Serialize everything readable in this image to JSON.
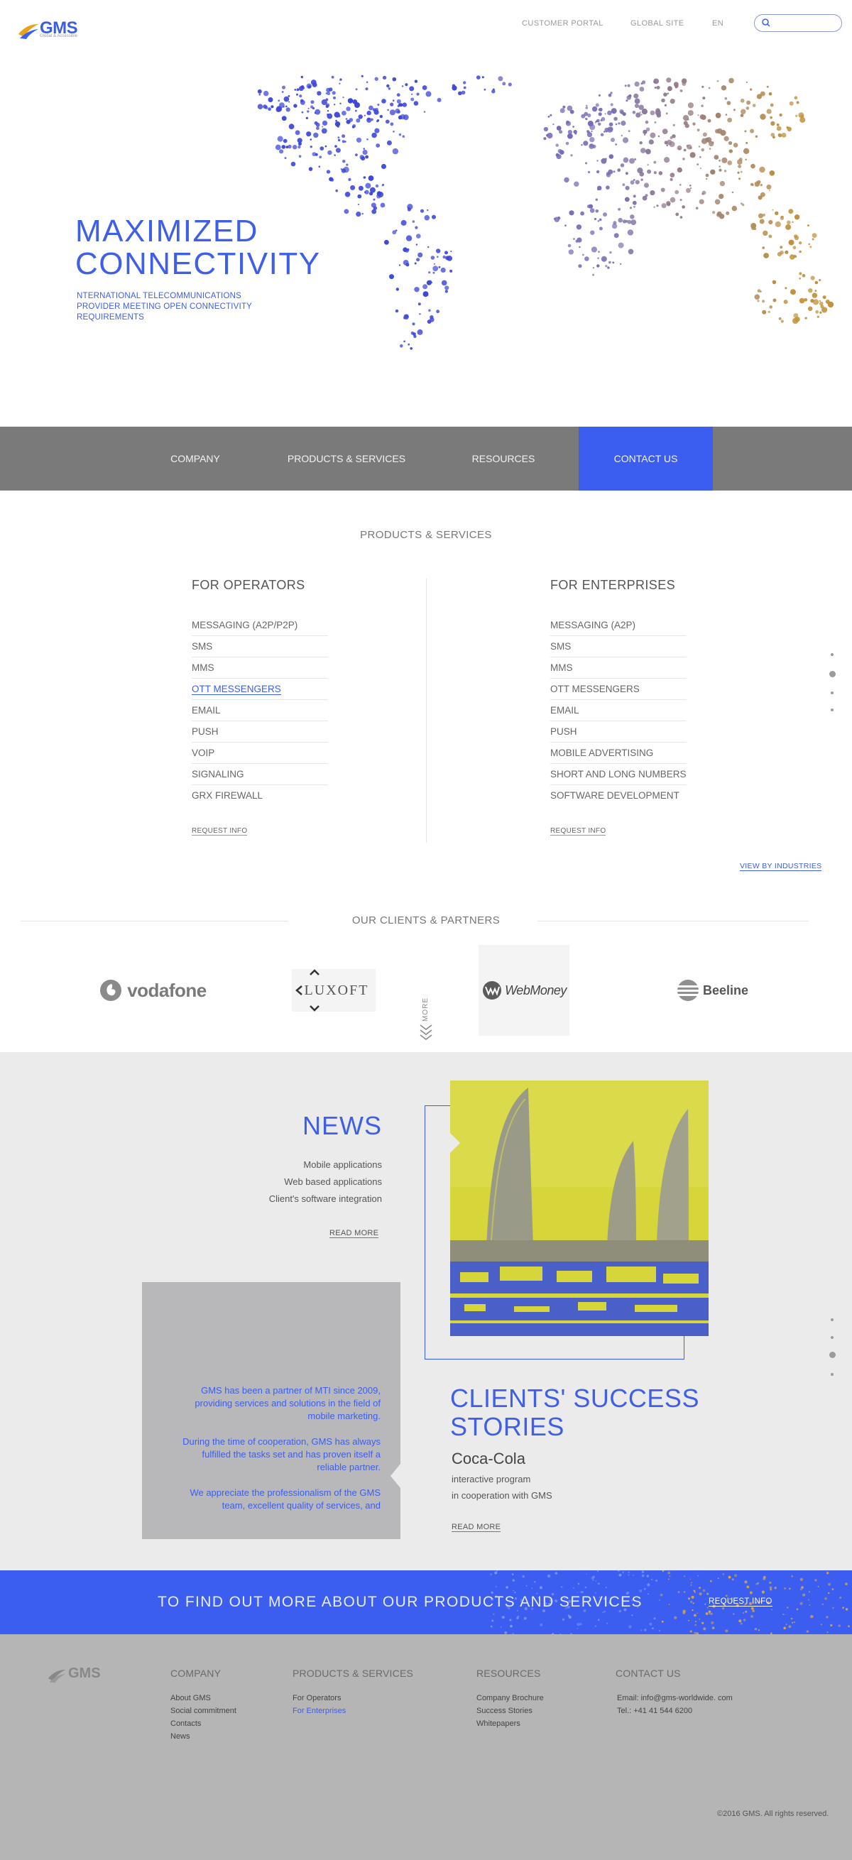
{
  "header": {
    "logo": "GMS",
    "logo_tagline": "Global & Accessible",
    "links": [
      "CUSTOMER PORTAL",
      "GLOBAL SITE",
      "EN"
    ],
    "search_placeholder": ""
  },
  "hero": {
    "title_line1": "MAXIMIZED",
    "title_line2": "CONNECTIVITY",
    "subtitle": "NTERNATIONAL TELECOMMUNICATIONS PROVIDER MEETING OPEN CONNECTIVITY REQUIREMENTS"
  },
  "nav": {
    "items": [
      "COMPANY",
      "PRODUCTS & SERVICES",
      "RESOURCES",
      "CONTACT US"
    ]
  },
  "products": {
    "title": "PRODUCTS & SERVICES",
    "operators": {
      "heading": "FOR OPERATORS",
      "items": [
        "MESSAGING (A2P/P2P)",
        "SMS",
        "MMS",
        "OTT MESSENGERS",
        "EMAIL",
        "PUSH",
        "VOIP",
        "SIGNALING",
        "GRX  FIREWALL"
      ],
      "request": "REQUEST INFO"
    },
    "enterprises": {
      "heading": "FOR  ENTERPRISES",
      "items": [
        "MESSAGING (A2P)",
        "SMS",
        "MMS",
        "OTT MESSENGERS",
        "EMAIL",
        "PUSH",
        "MOBILE ADVERTISING",
        "SHORT AND LONG NUMBERS",
        "SOFTWARE DEVELOPMENT"
      ],
      "request": "REQUEST INFO"
    },
    "view_industries": "VIEW BY INDUSTRIES"
  },
  "clients": {
    "title": "OUR CLIENTS & PARTNERS",
    "logos": [
      "vodafone",
      "LUXOFT",
      "WebMoney",
      "Beeline"
    ],
    "more": "MORE"
  },
  "news": {
    "title": "NEWS",
    "lines": [
      "Mobile applications",
      "Web based applications",
      "Client's software integration"
    ],
    "read_more": "READ MORE"
  },
  "testimonial": {
    "p1": "GMS has been a partner of MTI since 2009, providing services and solutions in the field of mobile marketing.",
    "p2": "During the time of cooperation, GMS has always fulfilled the tasks set and has proven itself a reliable partner.",
    "p3": "We appreciate the professionalism of the GMS team, excellent quality of services, and"
  },
  "success": {
    "title": "CLIENTS' SUCCESS STORIES",
    "client": "Coca-Cola",
    "line1": "interactive program",
    "line2": "in cooperation with GMS",
    "read_more": "READ MORE"
  },
  "cta": {
    "text": "TO FIND OUT MORE ABOUT OUR PRODUCTS AND SERVICES",
    "link": "REQUEST INFO"
  },
  "footer": {
    "logo": "GMS",
    "cols": [
      {
        "heading": "COMPANY",
        "links": [
          "About GMS",
          "Social commitment",
          "Contacts",
          "News"
        ]
      },
      {
        "heading": "PRODUCTS & SERVICES",
        "links": [
          "For Operators",
          "For Enterprises"
        ]
      },
      {
        "heading": "RESOURCES",
        "links": [
          "Company Brochure",
          "Success Stories",
          "Whitepapers"
        ]
      },
      {
        "heading": "CONTACT US",
        "links": [
          "Email: info@gms-worldwide. com",
          "Tel.: +41 41 544 6200"
        ]
      }
    ],
    "copyright": "©2016 GMS. All  rights reserved."
  },
  "colors": {
    "accent": "#3b5ef1",
    "map_west": "#3c47d8",
    "map_east": "#c0923b",
    "navbar": "#7a7a7a",
    "footer": "#b5b5b5"
  }
}
